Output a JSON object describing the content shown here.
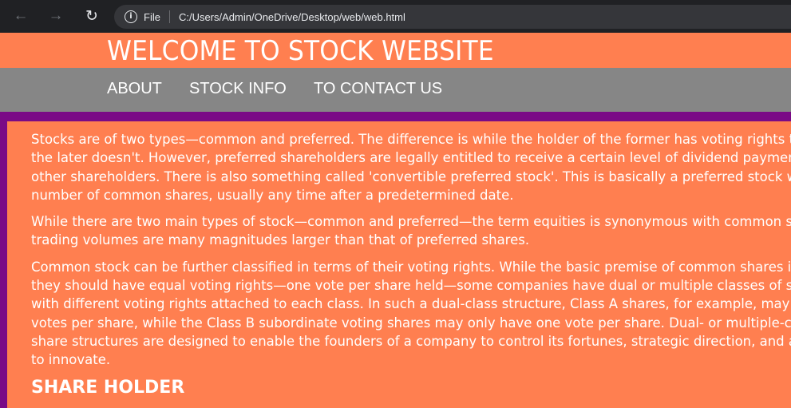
{
  "browser": {
    "back_icon": "arrow-left-icon",
    "forward_icon": "arrow-right-icon",
    "reload_icon": "reload-icon",
    "info_icon": "info-icon",
    "scheme": "File",
    "url": "C:/Users/Admin/OneDrive/Desktop/web/web.html"
  },
  "header": {
    "title": "WELCOME TO STOCK WEBSITE"
  },
  "nav": {
    "items": [
      {
        "label": "ABOUT"
      },
      {
        "label": "STOCK INFO"
      },
      {
        "label": "TO CONTACT US"
      }
    ]
  },
  "content": {
    "p1": [
      "Stocks are of two types—common and preferred. The difference is while the holder of the former has voting rights that",
      "the later doesn't. However, preferred shareholders are legally entitled to receive a certain level of dividend payments",
      "other shareholders. There is also something called 'convertible preferred stock'. This is basically a preferred stock wi",
      "number of common shares, usually any time after a predetermined date."
    ],
    "p2": [
      "While there are two main types of stock—common and preferred—the term equities is synonymous with common shar",
      "trading volumes are many magnitudes larger than that of preferred shares."
    ],
    "p3": [
      "Common stock can be further classified in terms of their voting rights. While the basic premise of common shares is th",
      "they should have equal voting rights—one vote per share held—some companies have dual or multiple classes of sto",
      "with different voting rights attached to each class. In such a dual-class structure, Class A shares, for example, may have",
      "votes per share, while the Class B subordinate voting shares may only have one vote per share. Dual- or multiple-cla",
      "share structures are designed to enable the founders of a company to control its fortunes, strategic direction, and abili",
      "to innovate."
    ],
    "subheading": "SHARE HOLDER"
  },
  "colors": {
    "accent": "#ff7f50",
    "nav_bg": "#868686",
    "page_bg": "#7a0a86",
    "chrome_bg": "#202124"
  }
}
